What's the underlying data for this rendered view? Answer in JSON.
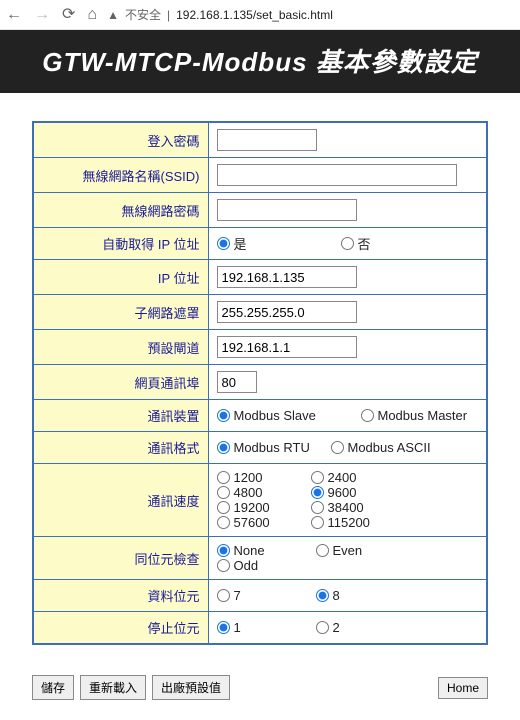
{
  "browser": {
    "insecure_label": "不安全",
    "url": "192.168.1.135/set_basic.html"
  },
  "header": {
    "title": "GTW-MTCP-Modbus 基本參數設定"
  },
  "labels": {
    "login_pw": "登入密碼",
    "ssid": "無線網路名稱(SSID)",
    "wifi_pw": "無線網路密碼",
    "auto_ip": "自動取得 IP 位址",
    "ip": "IP 位址",
    "subnet": "子網路遮罩",
    "gateway": "預設閘道",
    "web_port": "網頁通訊埠",
    "device": "通訊裝置",
    "format": "通訊格式",
    "baud": "通訊速度",
    "parity": "同位元檢查",
    "databits": "資料位元",
    "stopbits": "停止位元"
  },
  "values": {
    "login_pw": "",
    "ssid": "",
    "wifi_pw": "",
    "ip": "192.168.1.135",
    "subnet": "255.255.255.0",
    "gateway": "192.168.1.1",
    "web_port": "80"
  },
  "options": {
    "auto_ip": {
      "yes": "是",
      "no": "否"
    },
    "device": {
      "slave": "Modbus Slave",
      "master": "Modbus Master"
    },
    "format": {
      "rtu": "Modbus RTU",
      "ascii": "Modbus ASCII"
    },
    "baud": {
      "b1200": "1200",
      "b2400": "2400",
      "b4800": "4800",
      "b9600": "9600",
      "b19200": "19200",
      "b38400": "38400",
      "b57600": "57600",
      "b115200": "115200"
    },
    "parity": {
      "none": "None",
      "even": "Even",
      "odd": "Odd"
    },
    "databits": {
      "d7": "7",
      "d8": "8"
    },
    "stopbits": {
      "s1": "1",
      "s2": "2"
    }
  },
  "buttons": {
    "save": "儲存",
    "reload": "重新載入",
    "defaults": "出廠預設值",
    "home": "Home"
  }
}
